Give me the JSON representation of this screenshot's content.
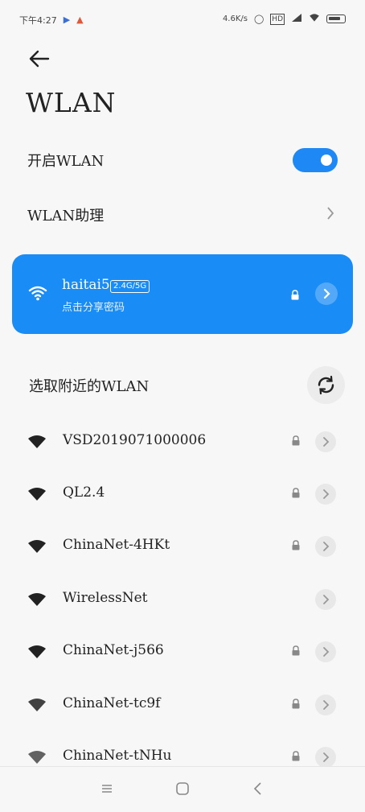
{
  "status_bar": {
    "time": "下午4:27",
    "speed": "4.6K/s",
    "battery_icon": "battery-icon",
    "wifi_icon": "wifi-icon",
    "signal_icon": "signal-icon"
  },
  "header": {
    "back_icon": "arrow-left-icon",
    "title": "WLAN"
  },
  "settings": {
    "enable_wlan_label": "开启WLAN",
    "enable_wlan_on": true,
    "wlan_assistant_label": "WLAN助理"
  },
  "connected": {
    "ssid": "haitai5",
    "band": "2.4G/5G",
    "share_hint": "点击分享密码",
    "locked": true,
    "color": "#1a8cf5"
  },
  "nearby": {
    "section_title": "选取附近的WLAN",
    "refresh_icon": "refresh-icon",
    "networks": [
      {
        "name": "VSD2019071000006",
        "locked": true
      },
      {
        "name": "QL2.4",
        "locked": true
      },
      {
        "name": "ChinaNet-4HKt",
        "locked": true
      },
      {
        "name": "WirelessNet",
        "locked": false
      },
      {
        "name": "ChinaNet-j566",
        "locked": true
      },
      {
        "name": "ChinaNet-tc9f",
        "locked": true
      },
      {
        "name": "ChinaNet-tNHu",
        "locked": true
      }
    ]
  },
  "nav_bar": {
    "menu_icon": "menu-icon",
    "home_icon": "home-icon",
    "back_icon": "back-icon"
  }
}
